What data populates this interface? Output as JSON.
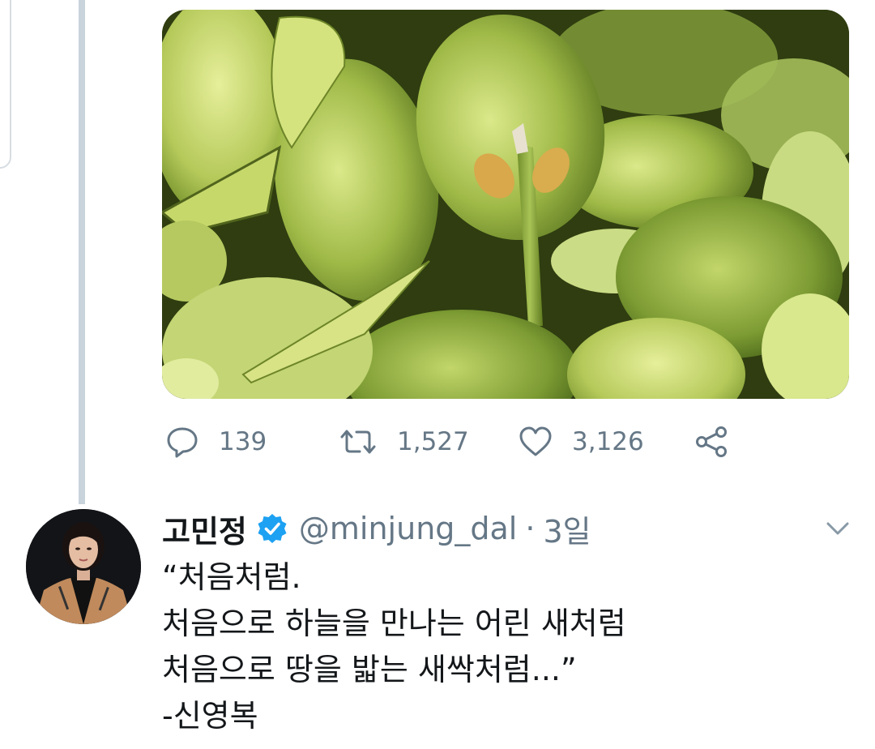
{
  "previous_tweet": {
    "media": {
      "icon": "plant-leaves-photo"
    },
    "actions": {
      "reply_count": "139",
      "retweet_count": "1,527",
      "like_count": "3,126"
    }
  },
  "tweet": {
    "display_name": "고민정",
    "handle": "@minjung_dal",
    "separator": "·",
    "time": "3일",
    "text_lines": [
      "“처음처럼.",
      "처음으로 하늘을 만나는 어린 새처럼",
      "처음으로 땅을 밟는 새싹처럼...”",
      "-신영복"
    ]
  },
  "colors": {
    "verified": "#1da1f2",
    "muted": "#657786",
    "text": "#14171a",
    "thread_line": "#c9d3db"
  }
}
